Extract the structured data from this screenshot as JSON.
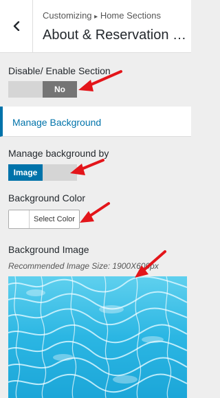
{
  "header": {
    "back_icon": "chevron-left-icon",
    "breadcrumb": "Customizing",
    "breadcrumb_separator": "▸",
    "breadcrumb_section": "Home Sections",
    "title": "About & Reservation Section"
  },
  "section_toggle": {
    "label": "Disable/ Enable Section",
    "value": "No"
  },
  "manage_background_tab": {
    "label": "Manage Background"
  },
  "background_by": {
    "label": "Manage background by",
    "value": "Image"
  },
  "background_color": {
    "label": "Background Color",
    "button": "Select Color"
  },
  "background_image": {
    "label": "Background Image",
    "hint": "Recommended Image Size: 1900X600px"
  },
  "colors": {
    "accent": "#0073aa",
    "annotation_arrow": "#e3151a",
    "water": "#2bb6e3"
  }
}
